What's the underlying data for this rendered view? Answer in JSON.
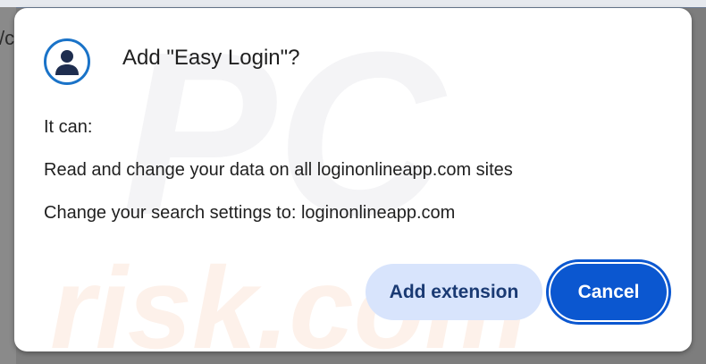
{
  "backdrop": {
    "glyph": "/c"
  },
  "dialog": {
    "icon": "user-avatar-icon",
    "title": "Add \"Easy Login\"?",
    "can_label": "It can:",
    "permissions": [
      "Read and change your data on all loginonlineapp.com sites",
      "Change your search settings to: loginonlineapp.com"
    ],
    "buttons": {
      "add_label": "Add extension",
      "cancel_label": "Cancel"
    },
    "watermark": {
      "top_text": "PC",
      "bottom_text": "risk.com"
    }
  },
  "colors": {
    "accent": "#0b57d0",
    "avatar_ring": "#1a73c8",
    "avatar_fill": "#1e2d4f",
    "secondary_button": "#d8e4fc",
    "text": "#1f1f1f"
  }
}
